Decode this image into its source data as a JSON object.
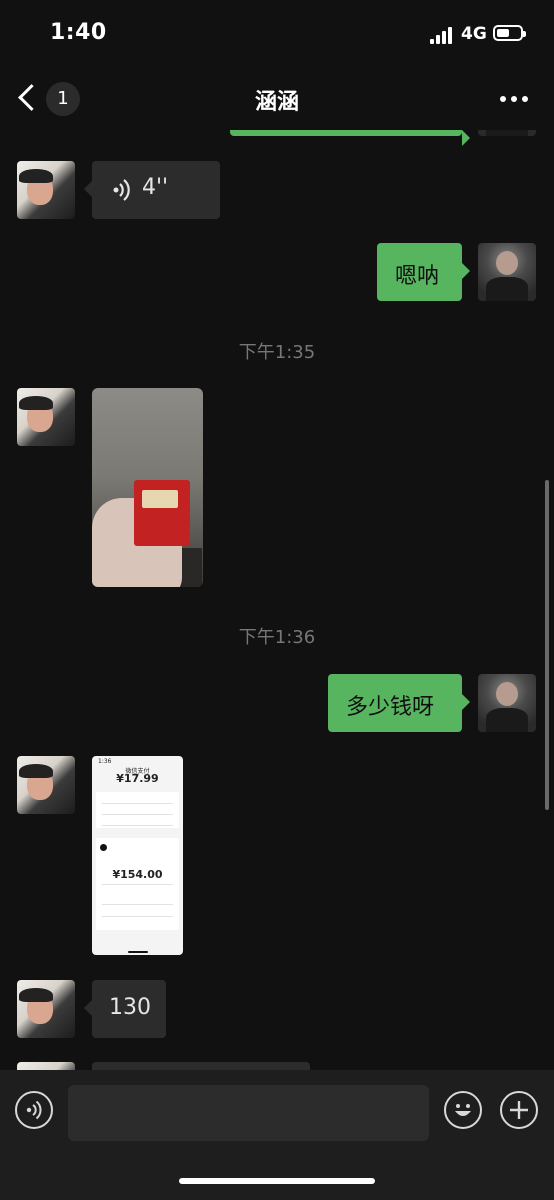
{
  "status_bar": {
    "time": "1:40",
    "network": "4G"
  },
  "nav": {
    "unread_count": "1",
    "title": "涵涵"
  },
  "messages": {
    "voice_duration": "4''",
    "reply_1": "嗯呐",
    "time_1": "下午1:35",
    "time_2": "下午1:36",
    "reply_2": "多少钱呀",
    "text_130": "130"
  },
  "receipt_thumb": {
    "status_time": "1:36",
    "title": "微信支付",
    "amount_top": "¥17.99",
    "amount_main": "¥154.00"
  },
  "input": {
    "placeholder": ""
  },
  "colors": {
    "accent_green": "#57b55f",
    "background": "#111111",
    "incoming_bubble": "#2c2c2c"
  },
  "icons": [
    "back-chevron-icon",
    "more-icon",
    "voice-wave-icon",
    "voice-input-icon",
    "emoji-icon",
    "plus-icon",
    "signal-icon",
    "battery-icon"
  ]
}
